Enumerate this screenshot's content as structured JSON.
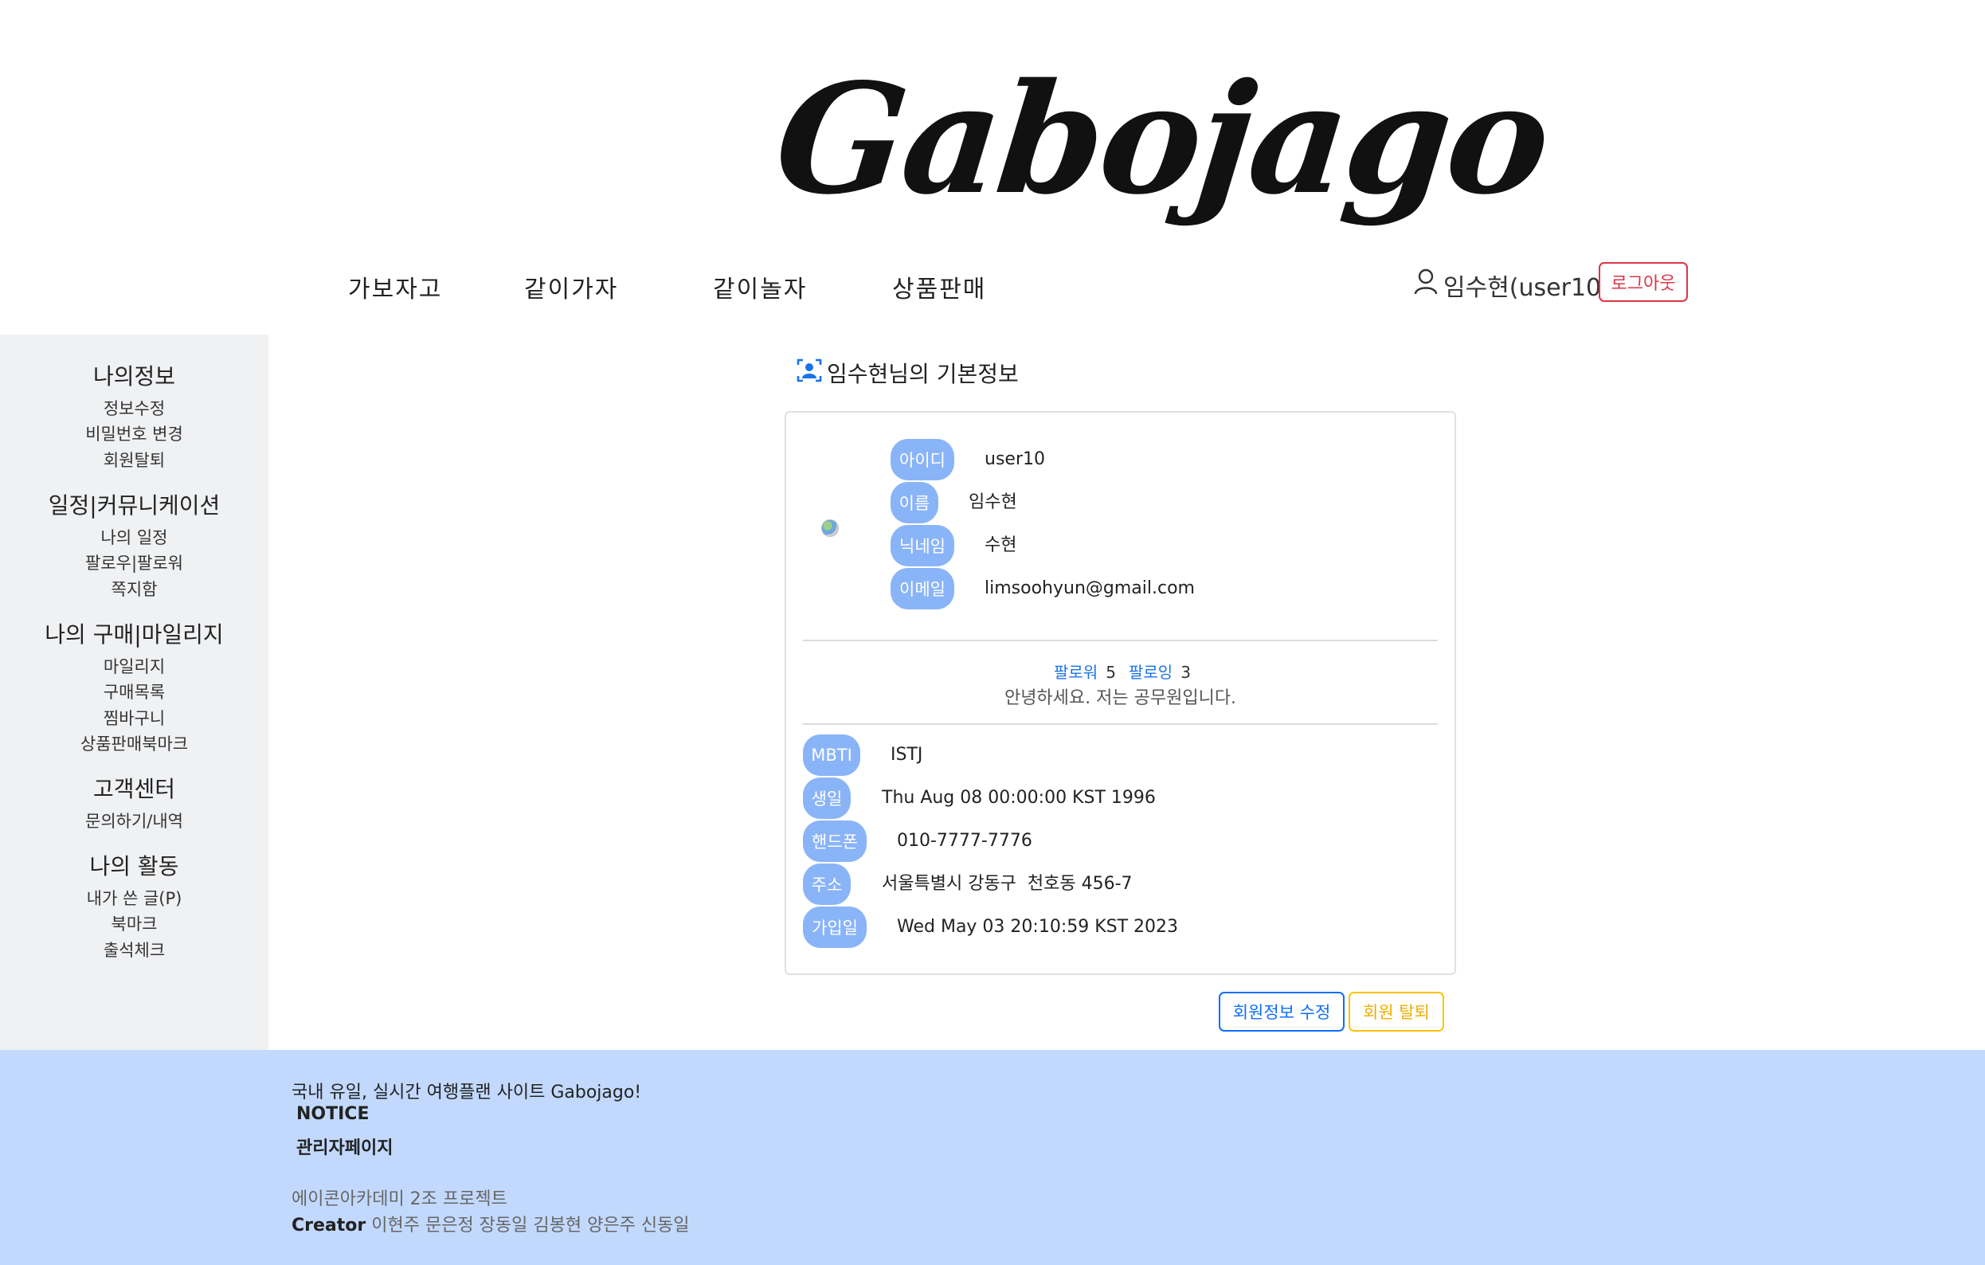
{
  "header": {
    "logo": "Gabojago",
    "nav": [
      "가보자고",
      "같이가자",
      "같이놀자",
      "상품판매"
    ],
    "user": "임수현(user10)",
    "logout": "로그아웃"
  },
  "sidebar": {
    "groups": [
      {
        "title": "나의정보",
        "items": [
          "정보수정",
          "비밀번호 변경",
          "회원탈퇴"
        ]
      },
      {
        "title": "일정|커뮤니케이션",
        "items": [
          "나의 일정",
          "팔로우|팔로워",
          "쪽지함"
        ]
      },
      {
        "title": "나의 구매|마일리지",
        "items": [
          "마일리지",
          "구매목록",
          "찜바구니",
          "상품판매북마크"
        ]
      },
      {
        "title": "고객센터",
        "items": [
          "문의하기/내역"
        ]
      },
      {
        "title": "나의 활동",
        "items": [
          "내가 쓴 글(P)",
          "북마크",
          "출석체크"
        ]
      }
    ]
  },
  "profile": {
    "title": "임수현님의 기본정보",
    "basic": [
      {
        "label": "아이디",
        "value": "user10"
      },
      {
        "label": "이름",
        "value": "임수현"
      },
      {
        "label": "닉네임",
        "value": "수현"
      },
      {
        "label": "이메일",
        "value": "limsoohyun@gmail.com"
      }
    ],
    "follower_label": "팔로워",
    "follower_count": "5",
    "following_label": "팔로잉",
    "following_count": "3",
    "intro": "안녕하세요. 저는 공무원입니다.",
    "details": [
      {
        "label": "MBTI",
        "value": "ISTJ"
      },
      {
        "label": "생일",
        "value": "Thu Aug 08 00:00:00 KST 1996"
      },
      {
        "label": "핸드폰",
        "value": "010-7777-7776"
      },
      {
        "label": "주소",
        "value": "서울특별시 강동구  천호동 456-7"
      },
      {
        "label": "가입일",
        "value": "Wed May 03 20:10:59 KST 2023"
      }
    ],
    "edit_button": "회원정보 수정",
    "leave_button": "회원 탈퇴"
  },
  "footer": {
    "tagline": "국내 유일, 실시간 여행플랜 사이트 Gabojago!",
    "notice": "NOTICE",
    "admin": "관리자페이지",
    "project": "에이콘아카데미 2조 프로젝트",
    "creator_label": "Creator",
    "creators": "이현주 문은정 장동일 김봉현 양은주 신동일"
  }
}
